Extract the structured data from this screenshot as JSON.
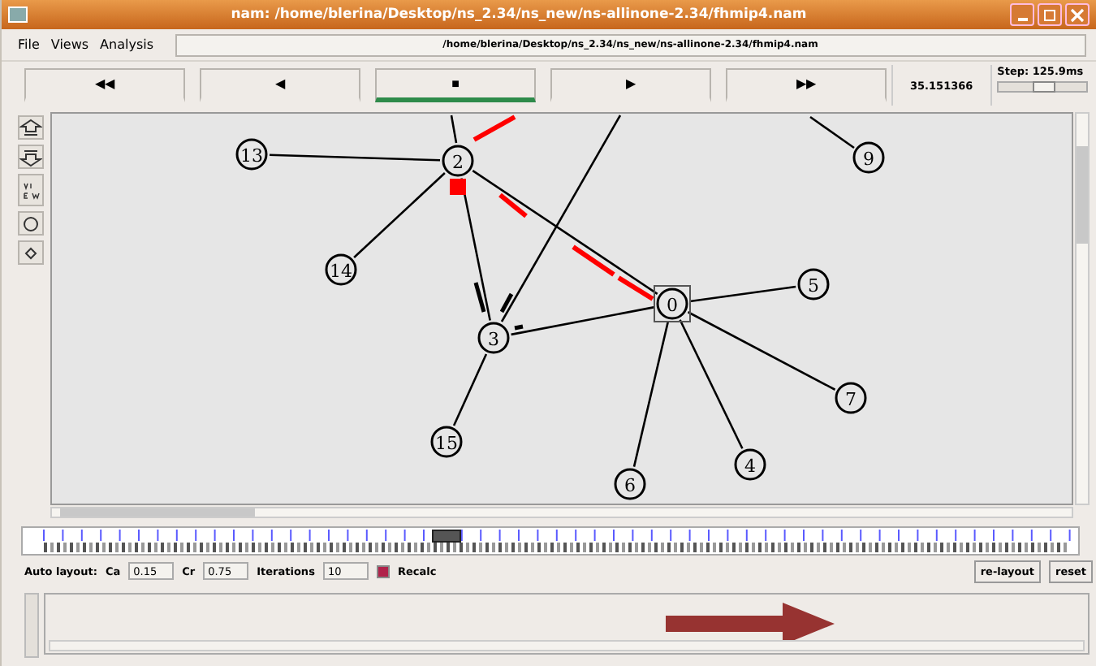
{
  "window": {
    "title": "nam: /home/blerina/Desktop/ns_2.34/ns_new/ns-allinone-2.34/fhmip4.nam"
  },
  "menu": [
    "File",
    "Views",
    "Analysis"
  ],
  "file_path": "/home/blerina/Desktop/ns_2.34/ns_new/ns-allinone-2.34/fhmip4.nam",
  "playback": [
    {
      "label": "◀◀",
      "selected": false
    },
    {
      "label": "◀",
      "selected": false
    },
    {
      "label": "■",
      "selected": true
    },
    {
      "label": "▶",
      "selected": false
    },
    {
      "label": "▶▶",
      "selected": false
    }
  ],
  "time": "35.151366",
  "step": {
    "label": "Step: 125.9ms",
    "level": 0.5
  },
  "nodes": [
    {
      "label": "13",
      "kind": "circle"
    },
    {
      "label": "2",
      "kind": "circle"
    },
    {
      "label": "9",
      "kind": "circle"
    },
    {
      "label": "14",
      "kind": "circle"
    },
    {
      "label": "0",
      "kind": "boxed"
    },
    {
      "label": "5",
      "kind": "circle"
    },
    {
      "label": "3",
      "kind": "circle"
    },
    {
      "label": "7",
      "kind": "circle"
    },
    {
      "label": "15",
      "kind": "circle"
    },
    {
      "label": "4",
      "kind": "circle"
    },
    {
      "label": "6",
      "kind": "circle"
    }
  ],
  "timeline": {
    "level": 0.4
  },
  "auto_layout": {
    "label": "Auto layout:",
    "fields": [
      {
        "label": "Ca",
        "value": "0.15"
      },
      {
        "label": "Cr",
        "value": "0.75"
      },
      {
        "label": "Iterations",
        "value": "10"
      }
    ],
    "recalc": {
      "label": "Recalc",
      "checked": true
    },
    "buttons": [
      "re-layout",
      "reset"
    ]
  }
}
